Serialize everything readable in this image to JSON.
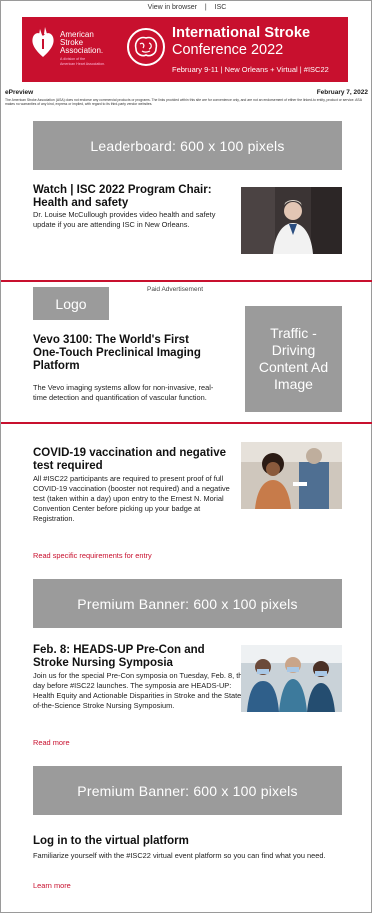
{
  "topbar": {
    "view_in_browser": "View in browser",
    "separator": "|",
    "isc": "ISC"
  },
  "header": {
    "aha_line1": "American",
    "aha_line2": "Stroke",
    "aha_line3": "Association.",
    "aha_sub1": "A division of the",
    "aha_sub2": "American Heart Association.",
    "title_line1": "International Stroke",
    "title_line2": "Conference 2022",
    "dates": "February 9-11 | New Orleans + Virtual | #ISC22"
  },
  "meta": {
    "label": "ePreview",
    "date": "February 7, 2022"
  },
  "disclaimer": "The American Stroke Association (ASA) does not endorse any commercial products or programs. The links provided within this site are for convenience only, and are not an endorsement of either the linked-to entity, product or service. ASA makes no warranties of any kind, express or implied, with regard to its third-party vendor websites.",
  "leaderboard": "Leaderboard: 600 x 100 pixels",
  "story1": {
    "title": "Watch | ISC 2022 Program Chair: Health and safety",
    "body": "Dr. Louise McCullough provides video health and safety update if you are attending ISC in New Orleans."
  },
  "ad": {
    "paid_label": "Paid Advertisement",
    "logo": "Logo",
    "title": "Vevo 3100: The World's First One-Touch Preclinical Imaging Platform",
    "body": "The Vevo imaging systems allow for non-invasive, real-time detection and quantification of vascular function.",
    "traffic": "Traffic - Driving Content Ad Image"
  },
  "story2": {
    "title": "COVID-19 vaccination and negative test required",
    "body": "All #ISC22 participants are required to present proof of full COVID-19 vaccination (booster not required) and a negative test (taken within a day) upon entry to the Ernest N. Morial Convention Center before picking up your badge at Registration.",
    "link": "Read specific requirements for entry"
  },
  "premium1": "Premium Banner: 600 x 100 pixels",
  "story3": {
    "title": "Feb. 8: HEADS-UP Pre-Con and Stroke Nursing Symposia",
    "body": "Join us for the special Pre-Con symposia on Tuesday, Feb. 8, the day before #ISC22 launches. The symposia are HEADS-UP: Health Equity and Actionable Disparities in Stroke and the State-of-the-Science Stroke Nursing Symposium.",
    "link": "Read more"
  },
  "premium2": "Premium Banner: 600 x 100 pixels",
  "story4": {
    "title": "Log in to the virtual platform",
    "body": "Familiarize yourself with the #ISC22 virtual event platform so you can find what you need.",
    "link": "Learn more"
  },
  "colors": {
    "brand_red": "#c8102e",
    "placeholder_gray": "#9b9b9b"
  }
}
